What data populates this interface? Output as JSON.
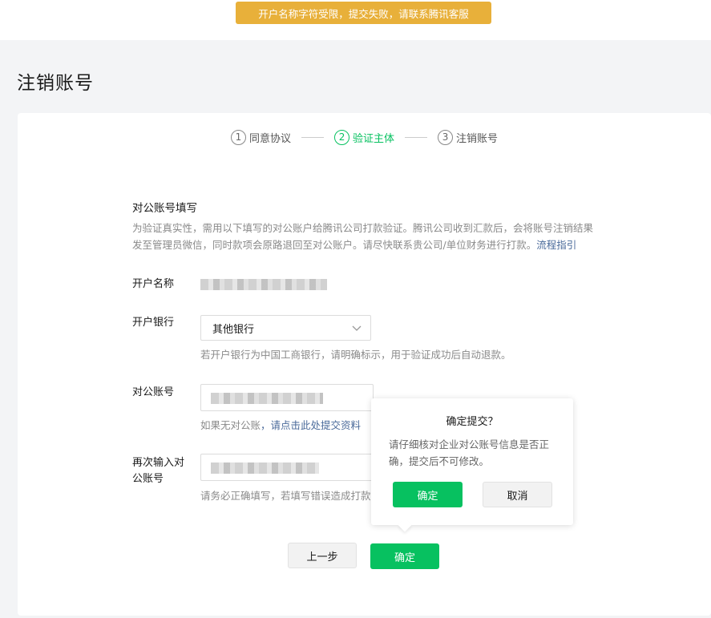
{
  "toast": {
    "message": "开户名称字符受限，提交失败，请联系腾讯客服"
  },
  "page": {
    "title": "注销账号"
  },
  "steps": [
    {
      "num": "1",
      "label": "同意协议"
    },
    {
      "num": "2",
      "label": "验证主体"
    },
    {
      "num": "3",
      "label": "注销账号"
    }
  ],
  "form": {
    "section_title": "对公账号填写",
    "description": "为验证真实性，需用以下填写的对公账户给腾讯公司打款验证。腾讯公司收到汇款后，会将账号注销结果发至管理员微信，同时款项会原路退回至对公账户。请尽快联系贵公司/单位财务进行打款。",
    "process_link": "流程指引",
    "account_name_label": "开户名称",
    "bank_label": "开户银行",
    "bank_value": "其他银行",
    "bank_hint": "若开户银行为中国工商银行，请明确标示，用于验证成功后自动退款。",
    "account_no_label": "对公账号",
    "account_no_hint_prefix": "如果无对公账",
    "account_no_hint_link": "，请点击此处提交资料",
    "confirm_account_label_line1": "再次输入对",
    "confirm_account_label_line2": "公账号",
    "confirm_account_hint": "请务必正确填写，若填写错误造成打款"
  },
  "buttons": {
    "prev": "上一步",
    "confirm": "确定"
  },
  "popover": {
    "title": "确定提交？",
    "text": "请仔细核对企业对公账号信息是否正确，提交后不可修改。",
    "ok": "确定",
    "cancel": "取消"
  },
  "colors": {
    "accent": "#07c160",
    "toast_bg": "#e8b03a",
    "link": "#4a6a9a"
  }
}
